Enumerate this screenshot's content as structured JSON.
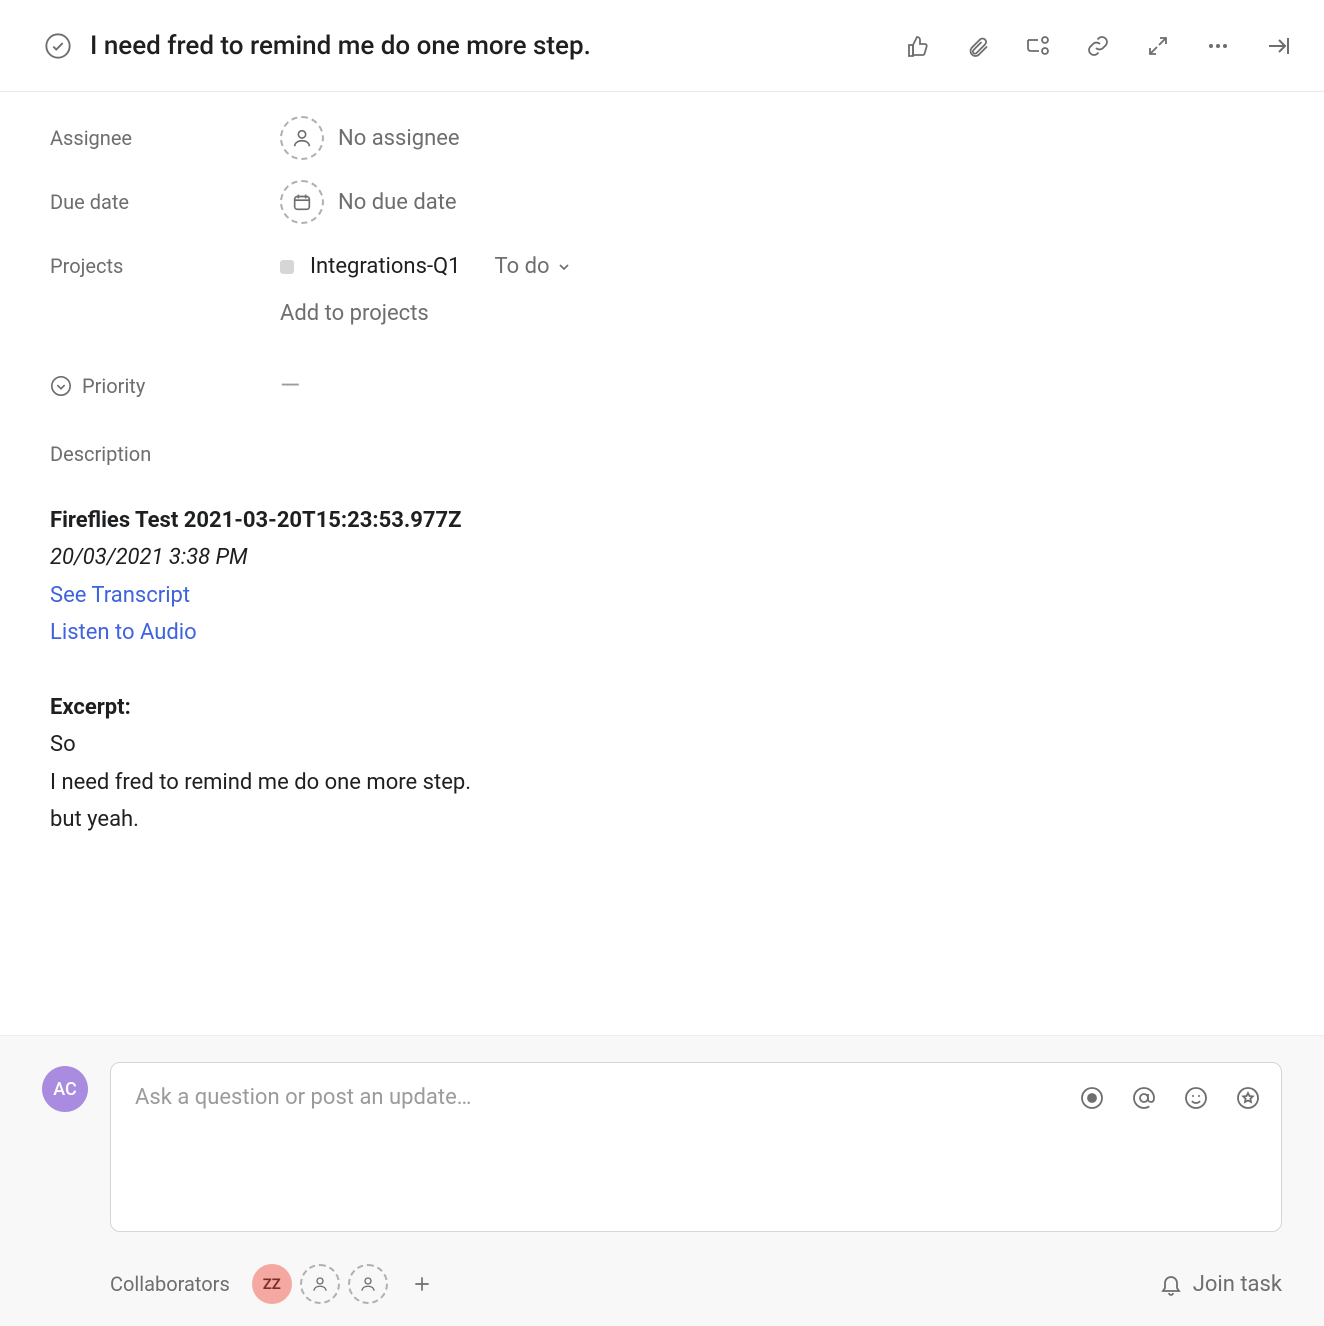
{
  "header": {
    "title": "I need fred to remind me do one more step."
  },
  "fields": {
    "assignee_label": "Assignee",
    "assignee_value": "No assignee",
    "due_label": "Due date",
    "due_value": "No due date",
    "projects_label": "Projects",
    "project_name": "Integrations-Q1",
    "project_status": "To do",
    "add_projects": "Add to projects",
    "priority_label": "Priority",
    "priority_value": "—",
    "description_label": "Description"
  },
  "description": {
    "title_line": "Fireflies Test 2021-03-20T15:23:53.977Z",
    "date_line": "20/03/2021 3:38 PM",
    "link_transcript": "See Transcript",
    "link_audio": "Listen to Audio",
    "excerpt_label": "Excerpt:",
    "line1": "So",
    "line2": "I need fred to remind me do one more step.",
    "line3": "but yeah."
  },
  "comment": {
    "avatar": "AC",
    "placeholder": "Ask a question or post an update…"
  },
  "collaborators": {
    "label": "Collaborators",
    "av1": "ZZ",
    "join": "Join task"
  }
}
